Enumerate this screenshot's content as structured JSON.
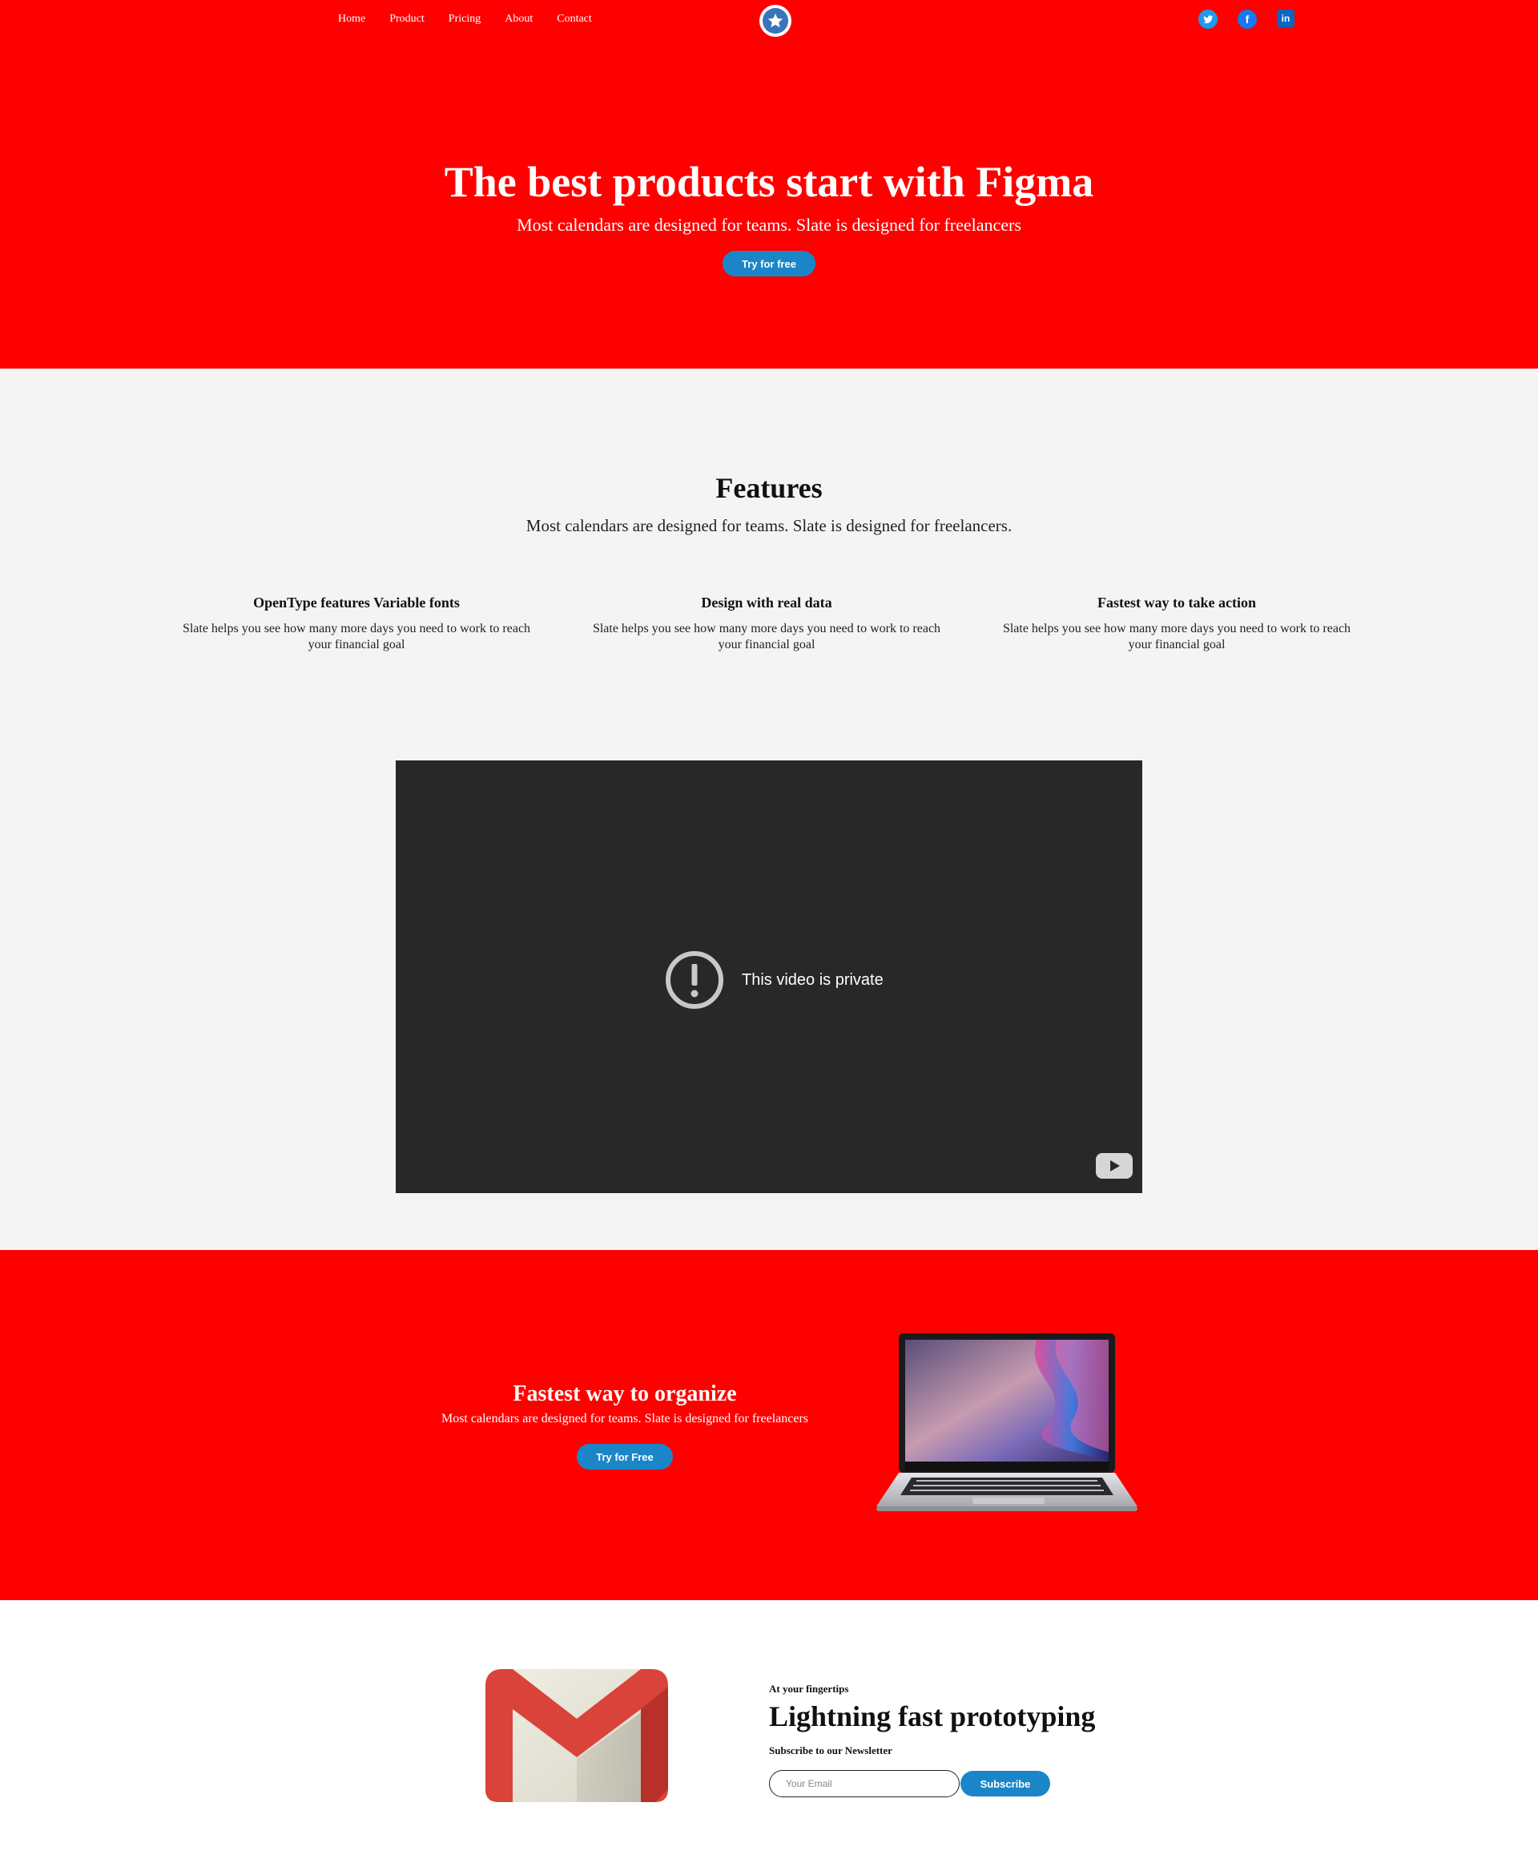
{
  "nav": {
    "links": [
      "Home",
      "Product",
      "Pricing",
      "About",
      "Contact"
    ],
    "logo_icon": "star-circle-icon",
    "socials": [
      {
        "name": "twitter-icon",
        "glyph": "t",
        "color": "#1d9bf0"
      },
      {
        "name": "facebook-icon",
        "glyph": "f",
        "color": "#1877f2"
      },
      {
        "name": "linkedin-icon",
        "glyph": "in",
        "color": "#0a66c2"
      }
    ]
  },
  "hero": {
    "title": "The best products start with Figma",
    "subtitle": "Most calendars are designed for teams. Slate is designed for freelancers",
    "cta": "Try for free",
    "background": "#ff0000"
  },
  "features": {
    "title": "Features",
    "subtitle": "Most calendars are designed for teams. Slate is designed for freelancers.",
    "items": [
      {
        "title": "OpenType features Variable fonts",
        "text": "Slate helps you see how many more days you need to work to reach your financial goal"
      },
      {
        "title": "Design with real data",
        "text": "Slate helps you see how many more days you need to work to reach your financial goal"
      },
      {
        "title": "Fastest way to take action",
        "text": "Slate helps you see how many more days you need to work to reach your financial goal"
      }
    ],
    "video": {
      "message": "This video is private",
      "icon": "alert-circle-icon",
      "brand_icon": "youtube-icon"
    }
  },
  "organize": {
    "title": "Fastest way to organize",
    "subtitle": "Most calendars are designed for teams. Slate is designed for freelancers",
    "cta": "Try for Free",
    "image": "laptop-image"
  },
  "newsletter": {
    "image": "gmail-logo",
    "kicker": "At your fingertips",
    "title": "Lightning fast prototyping",
    "subtitle": "Subscribe to our Newsletter",
    "email_placeholder": "Your Email",
    "cta": "Subscribe"
  },
  "colors": {
    "brand_red": "#ff0000",
    "accent_blue": "#1a86c8",
    "section_gray": "#f4f4f4",
    "video_bg": "#282828"
  }
}
